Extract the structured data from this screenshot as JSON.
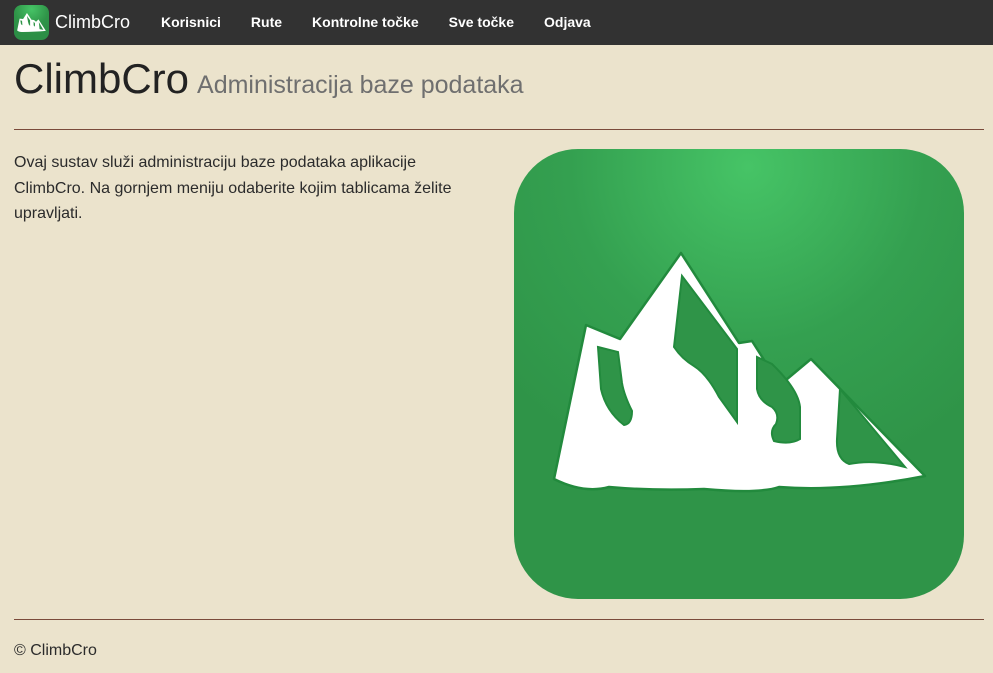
{
  "nav": {
    "brand": "ClimbCro",
    "logo_icon": "mountain-icon",
    "links": [
      {
        "label": "Korisnici"
      },
      {
        "label": "Rute"
      },
      {
        "label": "Kontrolne točke"
      },
      {
        "label": "Sve točke"
      },
      {
        "label": "Odjava"
      }
    ]
  },
  "header": {
    "title": "ClimbCro",
    "subtitle": "Administracija baze podataka"
  },
  "main": {
    "intro": "Ovaj sustav služi administraciju baze podataka aplikacije ClimbCro. Na gornjem meniju odaberite kojim tablicama želite upravljati.",
    "image_icon": "mountain-icon"
  },
  "footer": {
    "copyright": "© ClimbCro"
  },
  "colors": {
    "navbar_bg": "#323232",
    "page_bg": "#ebe3cc",
    "brand_green": "#2f9448",
    "rule": "#7a4a3a"
  }
}
